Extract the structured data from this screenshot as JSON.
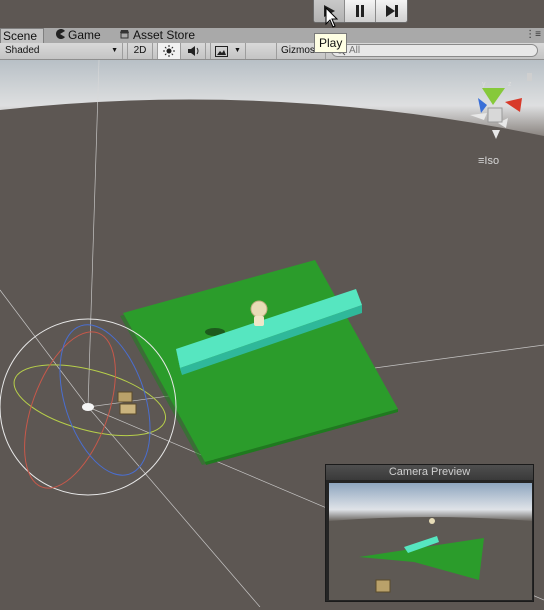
{
  "play_controls": {
    "play": "play-icon",
    "pause": "pause-icon",
    "step": "step-icon"
  },
  "tooltip": "Play",
  "tabs": [
    {
      "label": "Scene",
      "icon": "scene-icon"
    },
    {
      "label": "Game",
      "icon": "game-pacman-icon"
    },
    {
      "label": "Asset Store",
      "icon": "store-icon"
    }
  ],
  "toolbar": {
    "shading_mode": "Shaded",
    "mode_2d": "2D",
    "gizmos": "Gizmos",
    "search_placeholder": "All"
  },
  "gizmo": {
    "projection": "Iso",
    "axes": [
      "x",
      "y",
      "z"
    ]
  },
  "camera_preview": {
    "title": "Camera Preview"
  },
  "colors": {
    "ground": "#2b9c2b",
    "beam": "#56e6c0",
    "background": "#5d5753",
    "x_axis": "#d83a2a",
    "y_axis": "#86c93a",
    "z_axis": "#3a6fd8"
  }
}
